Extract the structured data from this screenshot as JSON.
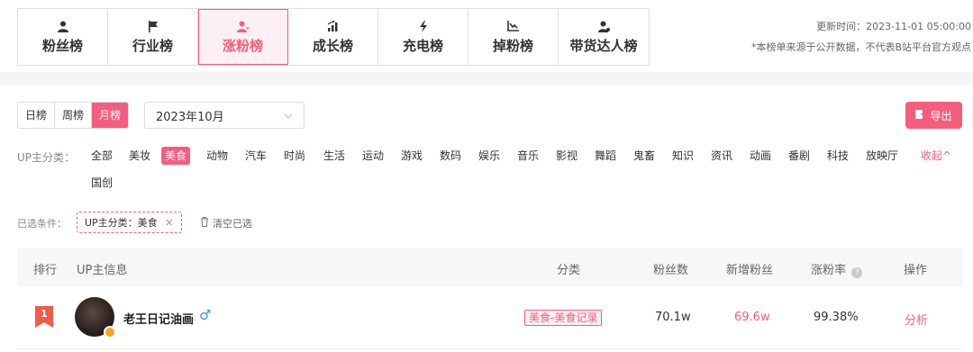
{
  "tabs": [
    {
      "label": "粉丝榜",
      "icon": "user-icon"
    },
    {
      "label": "行业榜",
      "icon": "flag-icon"
    },
    {
      "label": "涨粉榜",
      "icon": "user-up-icon",
      "active": true
    },
    {
      "label": "成长榜",
      "icon": "growth-bars-icon"
    },
    {
      "label": "充电榜",
      "icon": "lightning-icon"
    },
    {
      "label": "掉粉榜",
      "icon": "chart-down-icon"
    },
    {
      "label": "带货达人榜",
      "icon": "user-star-icon"
    }
  ],
  "header": {
    "update_time": "更新时间：2023-11-01 05:00:00",
    "notice": "*本榜单来源于公开数据，不代表B站平台官方观点"
  },
  "filters": {
    "periods": [
      "日榜",
      "周榜",
      "月榜"
    ],
    "active_period": "月榜",
    "month": "2023年10月",
    "export_label": "导出"
  },
  "category": {
    "label": "UP主分类：",
    "items": [
      "全部",
      "美妆",
      "美食",
      "动物",
      "汽车",
      "时尚",
      "生活",
      "运动",
      "游戏",
      "数码",
      "娱乐",
      "音乐",
      "影视",
      "舞蹈",
      "鬼畜",
      "知识",
      "资讯",
      "动画",
      "番剧",
      "科技",
      "放映厅",
      "国创"
    ],
    "active": "美食",
    "collapse_label": "收起^"
  },
  "selected": {
    "label": "已选条件：",
    "chip": "UP主分类：美食",
    "clear_label": "清空已选"
  },
  "table": {
    "headers": {
      "rank": "排行",
      "info": "UP主信息",
      "category": "分类",
      "fans": "粉丝数",
      "new_fans": "新增粉丝",
      "rate": "涨粉率",
      "action": "操作"
    },
    "rows": [
      {
        "rank": "1",
        "name": "老王日记油画",
        "gender": "♂",
        "category": "美食-美食记录",
        "fans": "70.1w",
        "new_fans": "69.6w",
        "rate": "99.38%",
        "action": "分析"
      }
    ]
  },
  "colors": {
    "accent": "#f45d7e",
    "accent_light": "#fdf0f3",
    "male_blue": "#3a8ee6"
  }
}
